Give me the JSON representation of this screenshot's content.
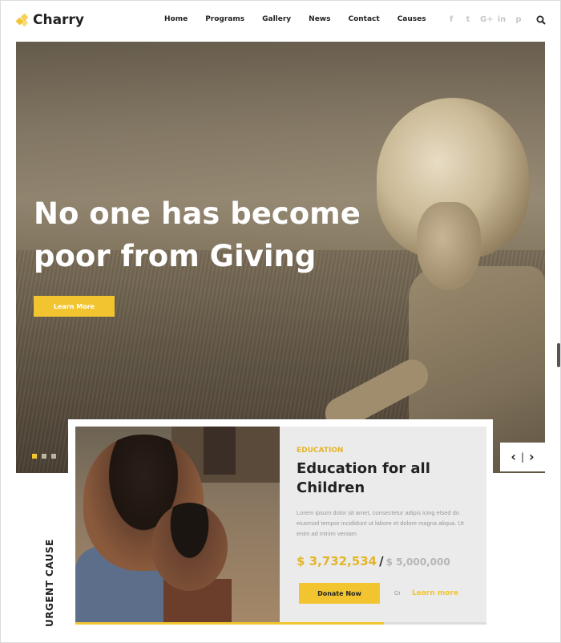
{
  "header": {
    "logo_text": "Charry",
    "nav": [
      "Home",
      "Programs",
      "Gallery",
      "News",
      "Contact",
      "Causes"
    ],
    "social_icons": [
      {
        "name": "facebook-icon",
        "glyph": "f"
      },
      {
        "name": "twitter-icon",
        "glyph": "t"
      },
      {
        "name": "google-plus-icon",
        "glyph": "G+"
      },
      {
        "name": "linkedin-icon",
        "glyph": "in"
      },
      {
        "name": "pinterest-icon",
        "glyph": "p"
      }
    ],
    "search_icon": "search-icon"
  },
  "hero": {
    "title": "No one has become poor from Giving",
    "button_label": "Learn More",
    "slides": 3,
    "active_slide": 0
  },
  "slider_controls": {
    "prev": "‹",
    "separator": "|",
    "next": "›"
  },
  "cause": {
    "section_label": "URGENT CAUSE",
    "category": "EDUCATION",
    "title": "Education for all Children",
    "description": "Lorem ipsum dolor sit amet, consectetur adipis icing elsed do eiusmod tempor incididunt ut labore et dolore magna aliqua. Ut enim ad minim veniam",
    "raised": "$ 3,732,534",
    "separator": "/",
    "goal": "$ 5,000,000",
    "donate_label": "Donate Now",
    "or_text": "Or",
    "learn_more_label": "Learn more",
    "progress_fraction": 0.75
  },
  "colors": {
    "accent": "#f2c530",
    "text": "#222222",
    "info_bg": "#ebebeb"
  }
}
